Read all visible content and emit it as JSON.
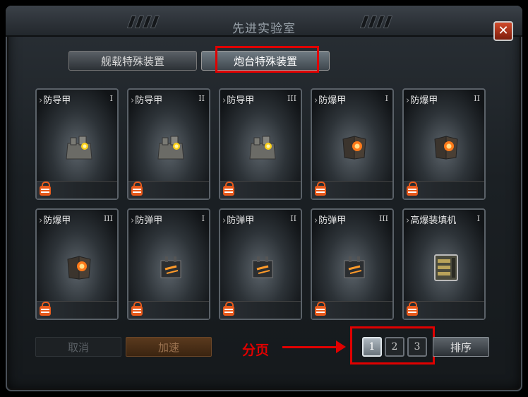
{
  "window": {
    "title": "先进实验室",
    "close_label": "✕"
  },
  "tabs": [
    {
      "label": "舰载特殊装置"
    },
    {
      "label": "炮台特殊装置"
    }
  ],
  "cards": [
    {
      "name": "防导甲",
      "level": "I",
      "item": "armor-tower-icon"
    },
    {
      "name": "防导甲",
      "level": "II",
      "item": "armor-tower-icon"
    },
    {
      "name": "防导甲",
      "level": "III",
      "item": "armor-tower-icon"
    },
    {
      "name": "防爆甲",
      "level": "I",
      "item": "blast-armor-icon"
    },
    {
      "name": "防爆甲",
      "level": "II",
      "item": "blast-armor-icon"
    },
    {
      "name": "防爆甲",
      "level": "III",
      "item": "blast-armor-icon"
    },
    {
      "name": "防弹甲",
      "level": "I",
      "item": "bullet-armor-icon"
    },
    {
      "name": "防弹甲",
      "level": "II",
      "item": "bullet-armor-icon"
    },
    {
      "name": "防弹甲",
      "level": "III",
      "item": "bullet-armor-icon"
    },
    {
      "name": "高爆装填机",
      "level": "I",
      "item": "loader-icon"
    }
  ],
  "actions": {
    "cancel": "取消",
    "speedup": "加速",
    "sort": "排序"
  },
  "pagination": {
    "pages": [
      "1",
      "2",
      "3"
    ],
    "current": "1"
  },
  "annotation": {
    "label": "分页"
  },
  "colors": {
    "annotation": "#e00000",
    "lock": "#e85a1c"
  }
}
